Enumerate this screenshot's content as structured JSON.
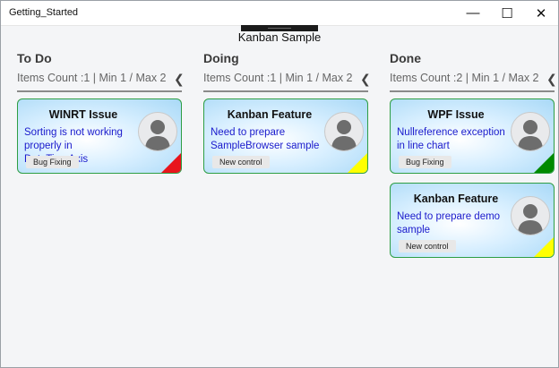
{
  "window": {
    "title": "Getting_Started",
    "minimize_glyph": "—",
    "maximize_glyph": "☐",
    "close_glyph": "✕"
  },
  "app": {
    "title": "Kanban Sample"
  },
  "columns": [
    {
      "title": "To Do",
      "info": "Items Count :1  |  Min 1 / Max 2",
      "collapse_glyph": "❮",
      "cards": [
        {
          "title": "WINRT Issue",
          "description": "Sorting is not working properly in DateTimeAxis",
          "tag": "Bug Fixing",
          "corner_color": "#e8141c",
          "avatar_icon": "user-icon"
        }
      ]
    },
    {
      "title": "Doing",
      "info": "Items Count :1  |  Min 1 / Max 2",
      "collapse_glyph": "❮",
      "cards": [
        {
          "title": "Kanban Feature",
          "description": "Need to prepare SampleBrowser sample",
          "tag": "New control",
          "corner_color": "#ffff00",
          "avatar_icon": "user-icon"
        }
      ]
    },
    {
      "title": "Done",
      "info": "Items Count :2  |  Min 1 / Max 2",
      "collapse_glyph": "❮",
      "cards": [
        {
          "title": "WPF Issue",
          "description": "Nullreference exception in line chart",
          "tag": "Bug Fixing",
          "corner_color": "#008a00",
          "avatar_icon": "user-icon"
        },
        {
          "title": "Kanban Feature",
          "description": "Need to prepare demo sample",
          "tag": "New control",
          "corner_color": "#ffff00",
          "avatar_icon": "user-icon"
        }
      ]
    }
  ],
  "colors": {
    "card_border": "#2e9e44",
    "description_text": "#1a1acc"
  }
}
